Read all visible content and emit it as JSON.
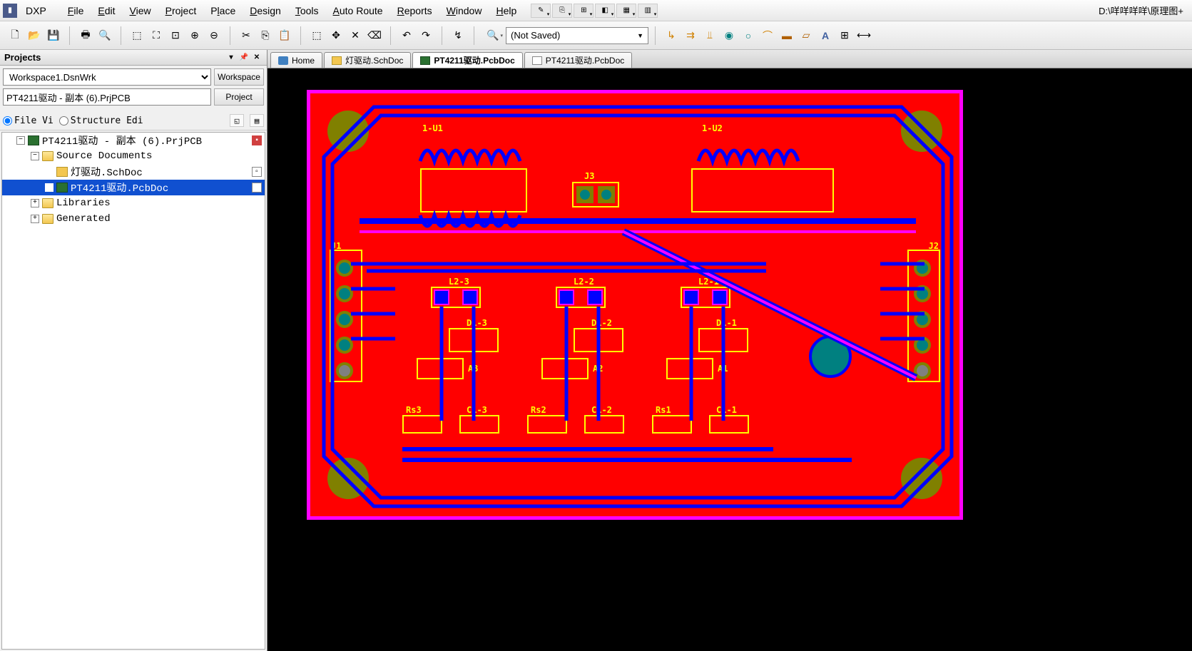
{
  "menubar": {
    "app": "DXP",
    "items": [
      "File",
      "Edit",
      "View",
      "Project",
      "Place",
      "Design",
      "Tools",
      "Auto Route",
      "Reports",
      "Window",
      "Help"
    ],
    "path": "D:\\咩咩咩咩\\原理图+"
  },
  "toolbar": {
    "doc_combo": "(Not Saved)"
  },
  "projects_panel": {
    "title": "Projects",
    "workspace_combo": "Workspace1.DsnWrk",
    "workspace_btn": "Workspace",
    "project_input": "PT4211驱动 - 副本 (6).PrjPCB",
    "project_btn": "Project",
    "view_file": "File Vi",
    "view_struct": "Structure Edi",
    "tree": {
      "root": "PT4211驱动 - 副本 (6).PrjPCB",
      "source_docs": "Source Documents",
      "sch": "灯驱动.SchDoc",
      "pcb": "PT4211驱动.PcbDoc",
      "libs": "Libraries",
      "gen": "Generated"
    }
  },
  "tabs": {
    "home": "Home",
    "sch": "灯驱动.SchDoc",
    "pcb1": "PT4211驱动.PcbDoc",
    "pcb2": "PT4211驱动.PcbDoc"
  },
  "pcb": {
    "designators": {
      "u1": "1-U1",
      "u2": "1-U2",
      "j1": "J1",
      "j2": "J2",
      "j3": "J3",
      "l23": "L2-3",
      "l22": "L2-2",
      "l21": "L2-1",
      "d13": "D1-3",
      "d12": "D1-2",
      "d11": "D1-1",
      "a3": "A3",
      "a2": "A2",
      "a1": "A1",
      "rs3": "Rs3",
      "c13": "C1-3",
      "rs2": "Rs2",
      "c12": "C1-2",
      "rs1": "Rs1",
      "c11": "C1-1"
    }
  }
}
